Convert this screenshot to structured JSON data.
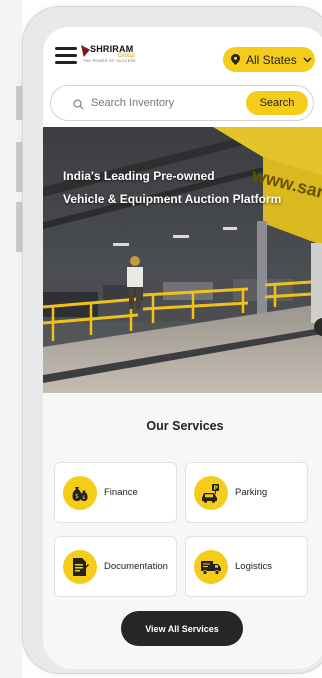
{
  "header": {
    "logo": {
      "name": "SHRIRAM",
      "script": "Group",
      "tagline": "THE POWER OF SUCCESS"
    },
    "state_selector": {
      "label": "All States",
      "icon": "location-pin-icon",
      "chevron": "chevron-down-icon"
    },
    "menu_icon": "hamburger-menu-icon"
  },
  "search": {
    "placeholder": "Search Inventory",
    "value": "",
    "button_label": "Search",
    "icon": "search-icon"
  },
  "hero": {
    "line1": "India's Leading Pre-owned",
    "line2": "Vehicle & Equipment Auction Platform",
    "sign_text": "www.sami"
  },
  "services": {
    "title": "Our Services",
    "items": [
      {
        "label": "Finance",
        "icon": "money-bags-icon"
      },
      {
        "label": "Parking",
        "icon": "parked-car-icon"
      },
      {
        "label": "Documentation",
        "icon": "document-icon"
      },
      {
        "label": "Logistics",
        "icon": "truck-icon"
      }
    ],
    "view_all_label": "View All Services"
  },
  "colors": {
    "accent": "#f6cc1b",
    "dark": "#262626",
    "background": "#f7f7f7"
  }
}
